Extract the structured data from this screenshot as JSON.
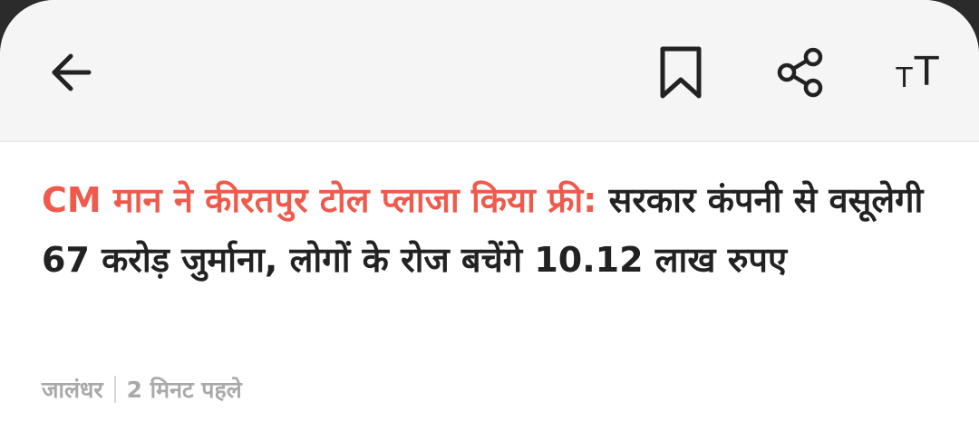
{
  "toolbar": {
    "back_icon": "arrow-left-icon",
    "bookmark_icon": "bookmark-icon",
    "share_icon": "share-icon",
    "font_size_icon_small": "T",
    "font_size_icon_big": "T"
  },
  "article": {
    "headline_highlight": "CM मान ने कीरतपुर टोल प्लाजा किया फ्री:",
    "headline_rest": " सरकार कंपनी से वसूलेगी 67 करोड़ जुर्माना, लोगों के रोज बचेंगे 10.12 लाख रुपए",
    "location": "जालंधर",
    "time": "2 मिनट पहले"
  },
  "colors": {
    "accent": "#ef5a4c",
    "text": "#222222",
    "meta": "#a9a9a9",
    "toolbar_bg": "#f5f5f5"
  }
}
